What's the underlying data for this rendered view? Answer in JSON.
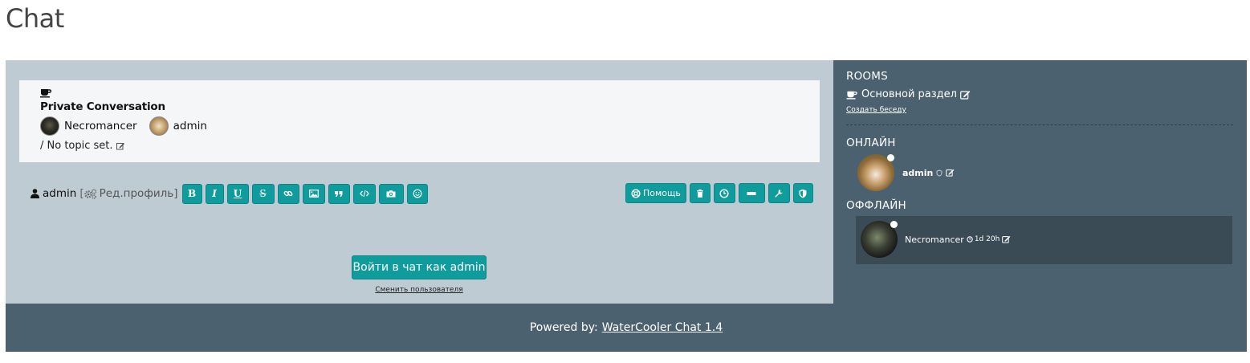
{
  "page": {
    "title": "Chat"
  },
  "conversation": {
    "title": "Private Conversation",
    "participants": [
      {
        "name": "Necromancer"
      },
      {
        "name": "admin"
      }
    ],
    "topic_prefix": "/ ",
    "topic": "No topic set."
  },
  "toolbar": {
    "username": "admin",
    "bracket_open": "[",
    "edit_profile_label": "Ред.профиль",
    "bracket_close": "]",
    "format_buttons": [
      "B",
      "I",
      "U",
      "S"
    ],
    "help_label": "Помощь"
  },
  "login": {
    "button_label": "Войти в чат как admin",
    "switch_user_label": "Сменить пользователя"
  },
  "sidebar": {
    "rooms_heading": "ROOMS",
    "room_name": "Основной раздел",
    "create_room_label": "Создать беседу",
    "online_heading": "ОНЛАЙН",
    "offline_heading": "ОФФЛАЙН",
    "online_users": [
      {
        "name": "admin"
      }
    ],
    "offline_users": [
      {
        "name": "Necromancer",
        "last_seen": "1d 20h"
      }
    ]
  },
  "footer": {
    "powered_by": "Powered by:",
    "link_label": "WaterCooler Chat 1.4"
  },
  "colors": {
    "accent": "#109c9c",
    "main_bg": "#bfcbd3",
    "sidebar_bg": "#4c6170",
    "offline_box_bg": "#3b4b56"
  }
}
